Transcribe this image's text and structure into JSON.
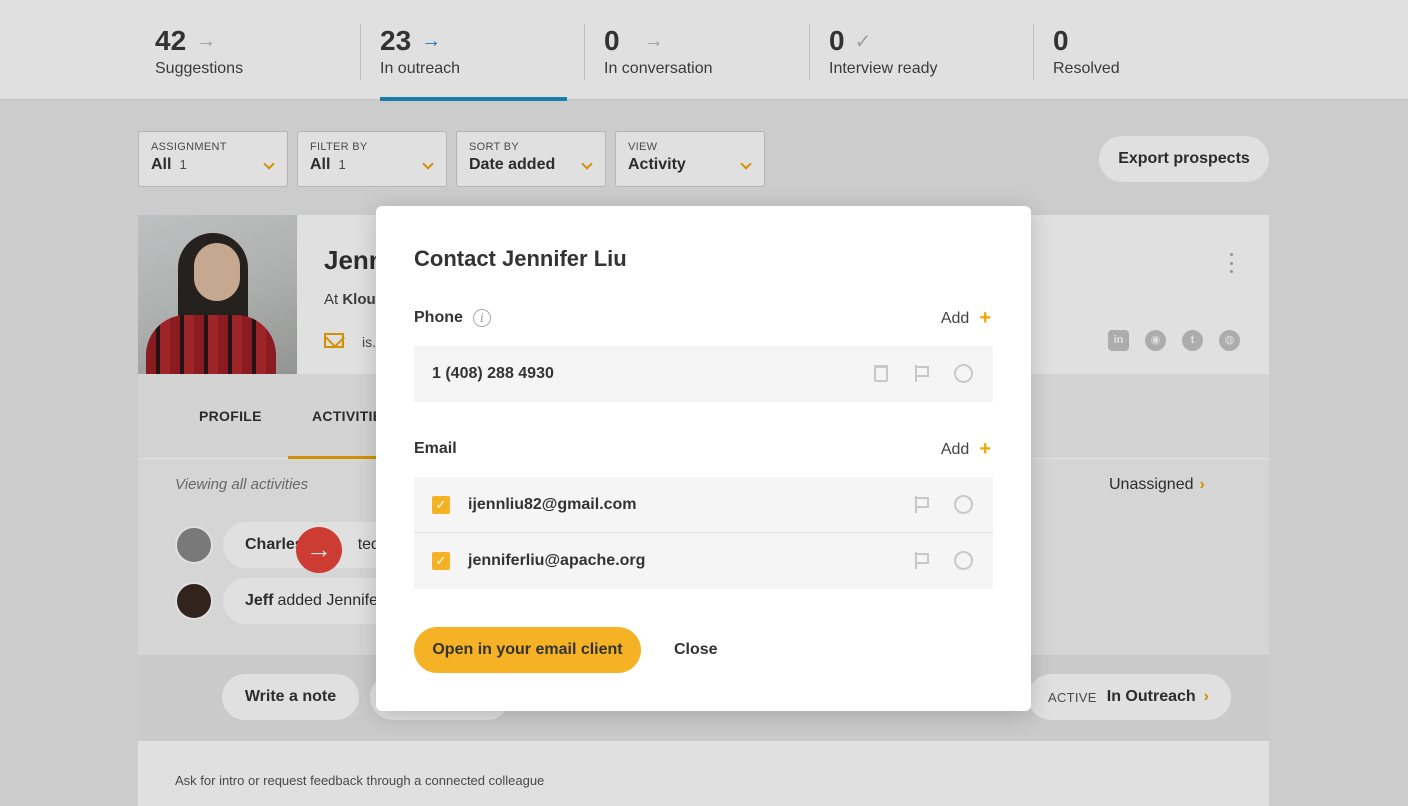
{
  "stats": [
    {
      "count": "42",
      "label": "Suggestions",
      "icon": "arrow-right-icon"
    },
    {
      "count": "23",
      "label": "In outreach",
      "icon": "arrow-right-icon",
      "active": true
    },
    {
      "count": "0",
      "label": "In conversation",
      "icon": "arrow-right-icon"
    },
    {
      "count": "0",
      "label": "Interview ready",
      "icon": "check-icon"
    },
    {
      "count": "0",
      "label": "Resolved"
    }
  ],
  "filters": {
    "assignment": {
      "caption": "ASSIGNMENT",
      "value": "All",
      "count": "1"
    },
    "filter_by": {
      "caption": "FILTER BY",
      "value": "All",
      "count": "1"
    },
    "sort_by": {
      "caption": "SORT BY",
      "value": "Date added"
    },
    "view": {
      "caption": "VIEW",
      "value": "Activity"
    }
  },
  "export_label": "Export prospects",
  "profile": {
    "name_fragment": "Jenn",
    "at_prefix": "At ",
    "company_fragment": "Klou",
    "email_fragment": "is."
  },
  "tabs": {
    "profile": "PROFILE",
    "activities": "ACTIVITIE"
  },
  "activity": {
    "viewing": "Viewing all activities",
    "unassigned": "Unassigned",
    "rows": [
      {
        "actor": "Charles",
        "text": "ted Je"
      },
      {
        "actor": "Jeff",
        "text": "added Jennife"
      }
    ]
  },
  "bottom": {
    "write_note": "Write a note",
    "stage_caption": "ACTIVE",
    "stage_value": "In Outreach",
    "intro_text": "Ask for intro or request feedback through a connected colleague"
  },
  "modal": {
    "title": "Contact Jennifer Liu",
    "phone_label": "Phone",
    "email_label": "Email",
    "add_label": "Add",
    "phone": "1 (408) 288 4930",
    "emails": [
      "ijennliu82@gmail.com",
      "jenniferliu@apache.org"
    ],
    "primary_button": "Open in your email client",
    "close_button": "Close"
  },
  "colors": {
    "accent": "#f5b225",
    "active_tab": "#1a8fc4",
    "fab": "#e9453b"
  }
}
